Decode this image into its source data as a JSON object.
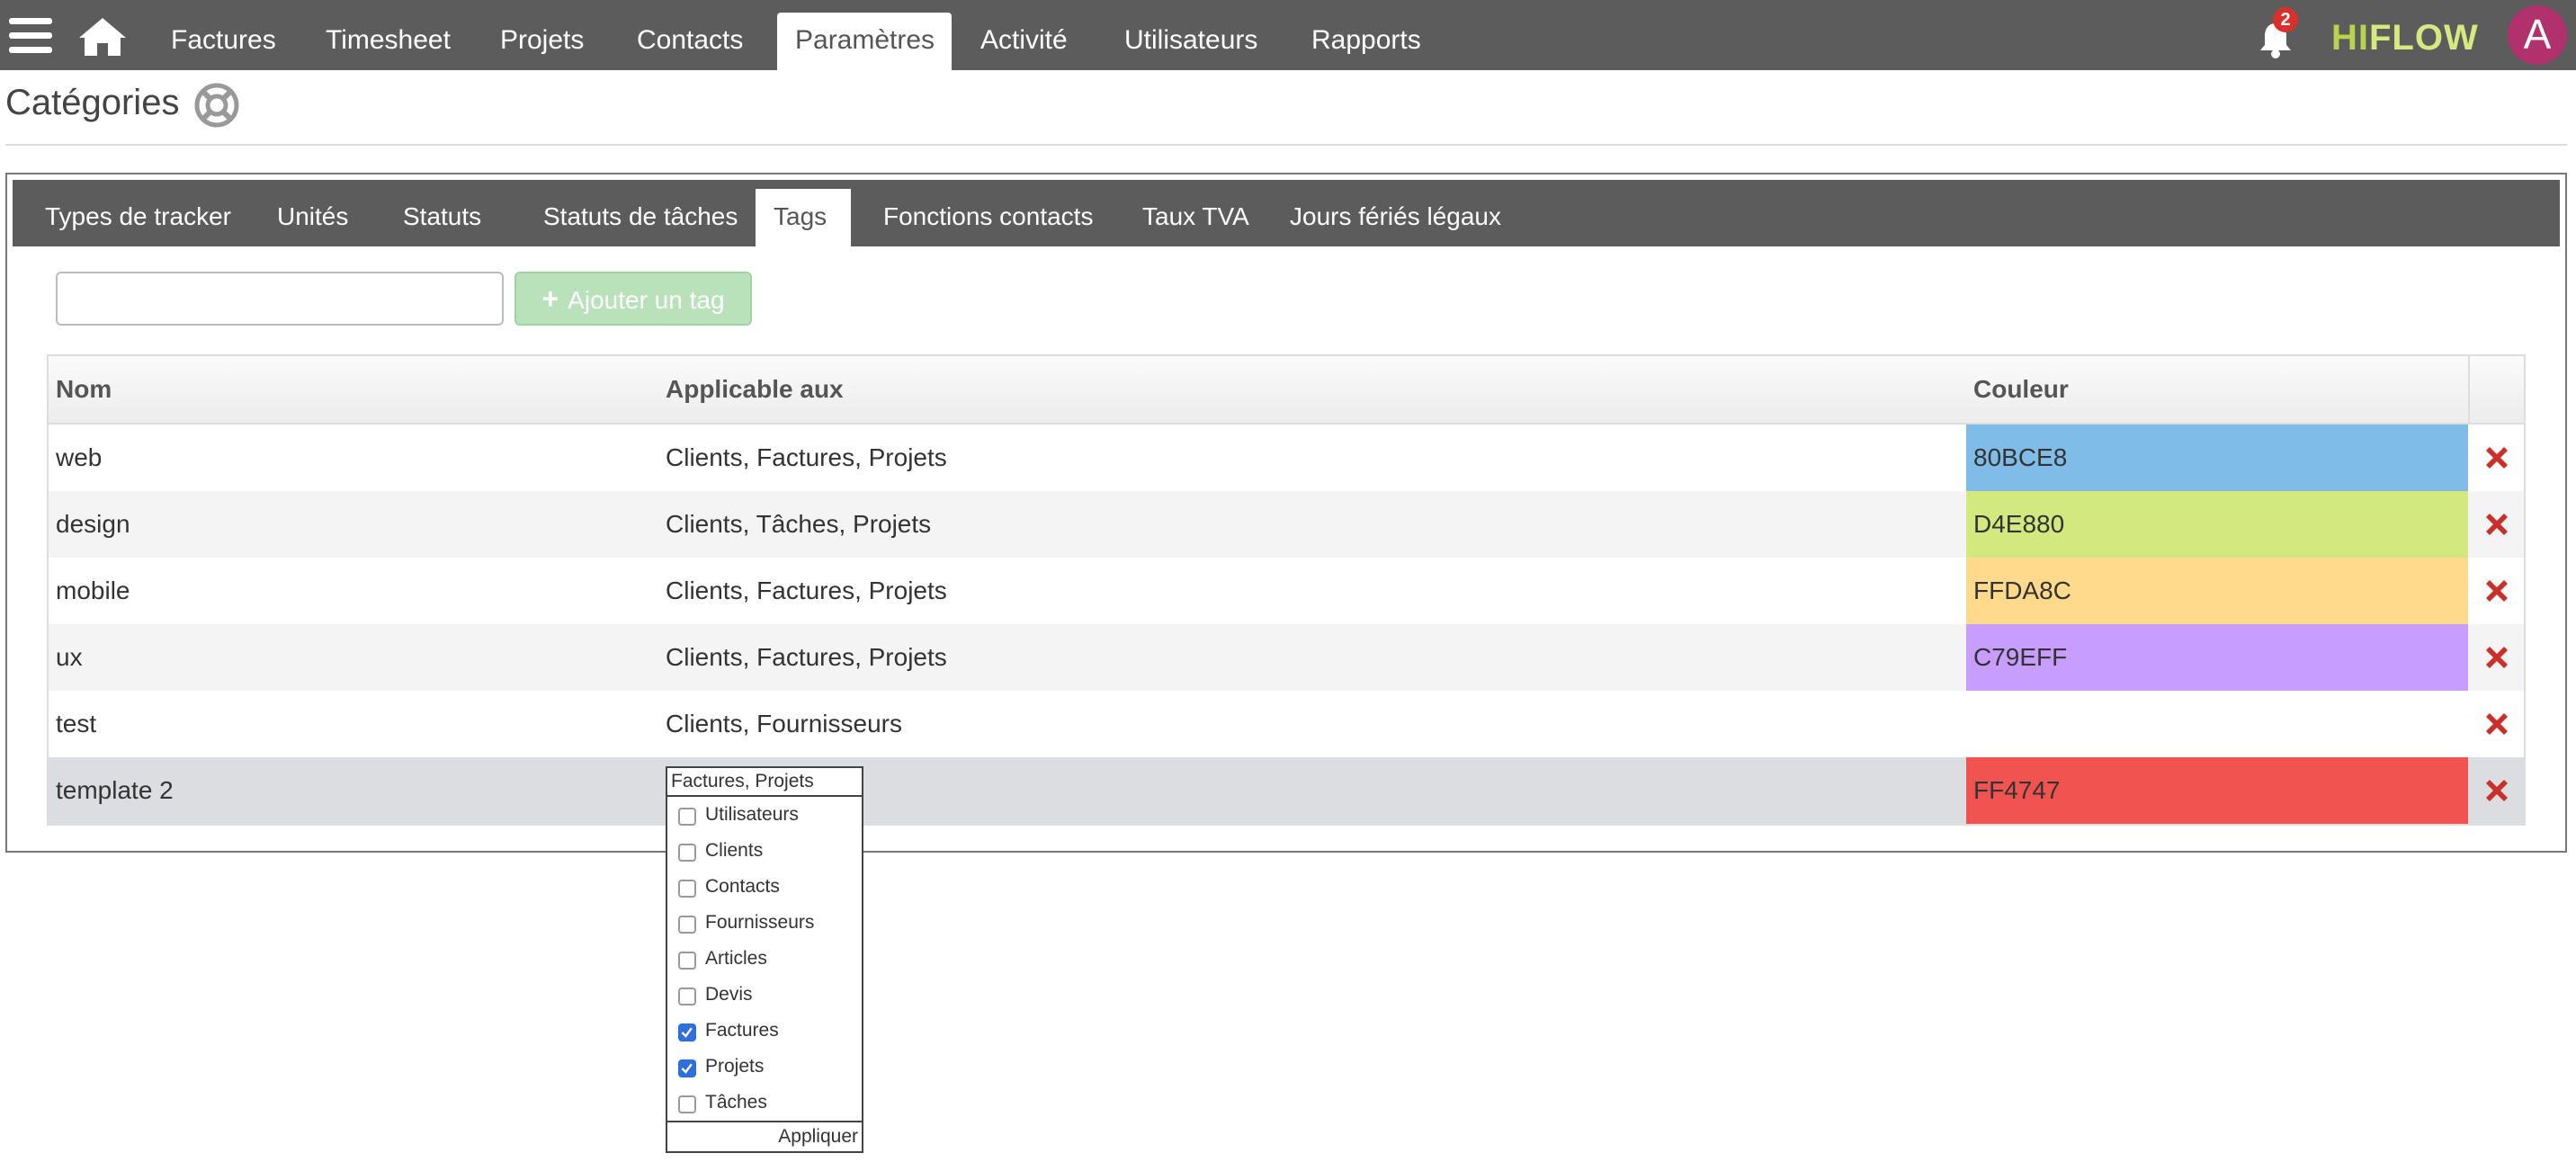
{
  "nav": {
    "items": [
      {
        "label": "Factures"
      },
      {
        "label": "Timesheet"
      },
      {
        "label": "Projets"
      },
      {
        "label": "Contacts"
      },
      {
        "label": "Paramètres"
      },
      {
        "label": "Activité"
      },
      {
        "label": "Utilisateurs"
      },
      {
        "label": "Rapports"
      }
    ],
    "active": "Paramètres",
    "notification_count": "2",
    "logo_hi": "HI",
    "logo_flow": "FLOW",
    "avatar_letter": "A"
  },
  "page": {
    "title": "Catégories"
  },
  "tabs": {
    "items": [
      {
        "label": "Types de tracker"
      },
      {
        "label": "Unités"
      },
      {
        "label": "Statuts"
      },
      {
        "label": "Statuts de tâches"
      },
      {
        "label": "Tags"
      },
      {
        "label": "Fonctions contacts"
      },
      {
        "label": "Taux TVA"
      },
      {
        "label": "Jours fériés légaux"
      }
    ],
    "active": "Tags"
  },
  "add_tag": {
    "input_value": "",
    "button_label": "Ajouter un tag"
  },
  "table": {
    "headers": {
      "name": "Nom",
      "applicable": "Applicable aux",
      "color": "Couleur"
    },
    "rows": [
      {
        "name": "web",
        "applicable": "Clients, Factures, Projets",
        "color": "80BCE8",
        "hex": "#80BCE8"
      },
      {
        "name": "design",
        "applicable": "Clients, Tâches, Projets",
        "color": "D4E880",
        "hex": "#D4E880"
      },
      {
        "name": "mobile",
        "applicable": "Clients, Factures, Projets",
        "color": "FFDA8C",
        "hex": "#FFDA8C"
      },
      {
        "name": "ux",
        "applicable": "Clients, Factures, Projets",
        "color": "C79EFF",
        "hex": "#C79EFF"
      },
      {
        "name": "test",
        "applicable": "Clients, Fournisseurs",
        "color": "",
        "hex": ""
      },
      {
        "name": "template 2",
        "applicable": "",
        "color": "FF4747",
        "hex": "#FF4747"
      }
    ]
  },
  "multiselect": {
    "value": "Factures, Projets",
    "options": [
      {
        "label": "Utilisateurs",
        "checked": false
      },
      {
        "label": "Clients",
        "checked": false
      },
      {
        "label": "Contacts",
        "checked": false
      },
      {
        "label": "Fournisseurs",
        "checked": false
      },
      {
        "label": "Articles",
        "checked": false
      },
      {
        "label": "Devis",
        "checked": false
      },
      {
        "label": "Factures",
        "checked": true
      },
      {
        "label": "Projets",
        "checked": true
      },
      {
        "label": "Tâches",
        "checked": false
      }
    ],
    "apply_label": "Appliquer"
  },
  "colors": {
    "topbar": "#5c5c5c",
    "delete": "#c9302c",
    "checkbox_on": "#2f6fdb"
  }
}
